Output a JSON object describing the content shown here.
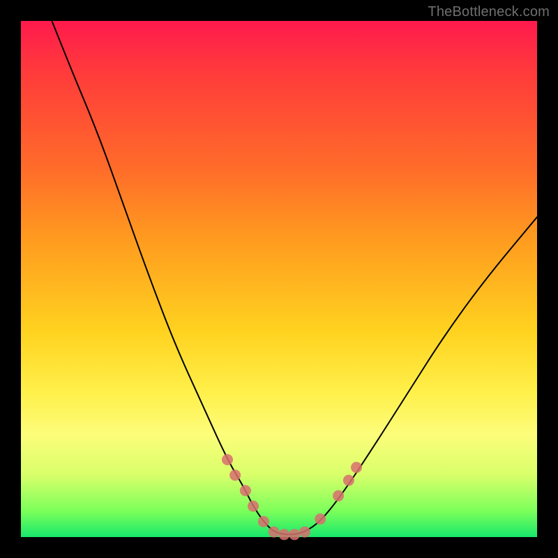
{
  "watermark": "TheBottleneck.com",
  "chart_data": {
    "type": "line",
    "title": "",
    "xlabel": "",
    "ylabel": "",
    "xlim": [
      0,
      100
    ],
    "ylim": [
      0,
      100
    ],
    "grid": false,
    "legend": false,
    "series": [
      {
        "name": "bottleneck-curve",
        "x": [
          6,
          10,
          15,
          20,
          25,
          30,
          35,
          40,
          43,
          45,
          47,
          49,
          51,
          53,
          55,
          58,
          62,
          68,
          75,
          82,
          90,
          100
        ],
        "y": [
          100,
          90,
          78,
          64,
          50,
          37,
          26,
          15,
          10,
          6,
          3,
          1,
          0.5,
          0.5,
          1,
          3,
          8,
          17,
          28,
          39,
          50,
          62
        ],
        "color": "#000000",
        "stroke_width": 2
      }
    ],
    "markers": [
      {
        "name": "curve-dots",
        "color": "#d86e6e",
        "radius": 8,
        "points": [
          {
            "x": 40.0,
            "y": 15.0
          },
          {
            "x": 41.5,
            "y": 12.0
          },
          {
            "x": 43.5,
            "y": 9.0
          },
          {
            "x": 45.0,
            "y": 6.0
          },
          {
            "x": 47.0,
            "y": 3.0
          },
          {
            "x": 49.0,
            "y": 1.0
          },
          {
            "x": 51.0,
            "y": 0.5
          },
          {
            "x": 53.0,
            "y": 0.5
          },
          {
            "x": 55.0,
            "y": 1.0
          },
          {
            "x": 58.0,
            "y": 3.5
          },
          {
            "x": 61.5,
            "y": 8.0
          },
          {
            "x": 63.5,
            "y": 11.0
          },
          {
            "x": 65.0,
            "y": 13.5
          }
        ]
      }
    ],
    "annotations": []
  }
}
